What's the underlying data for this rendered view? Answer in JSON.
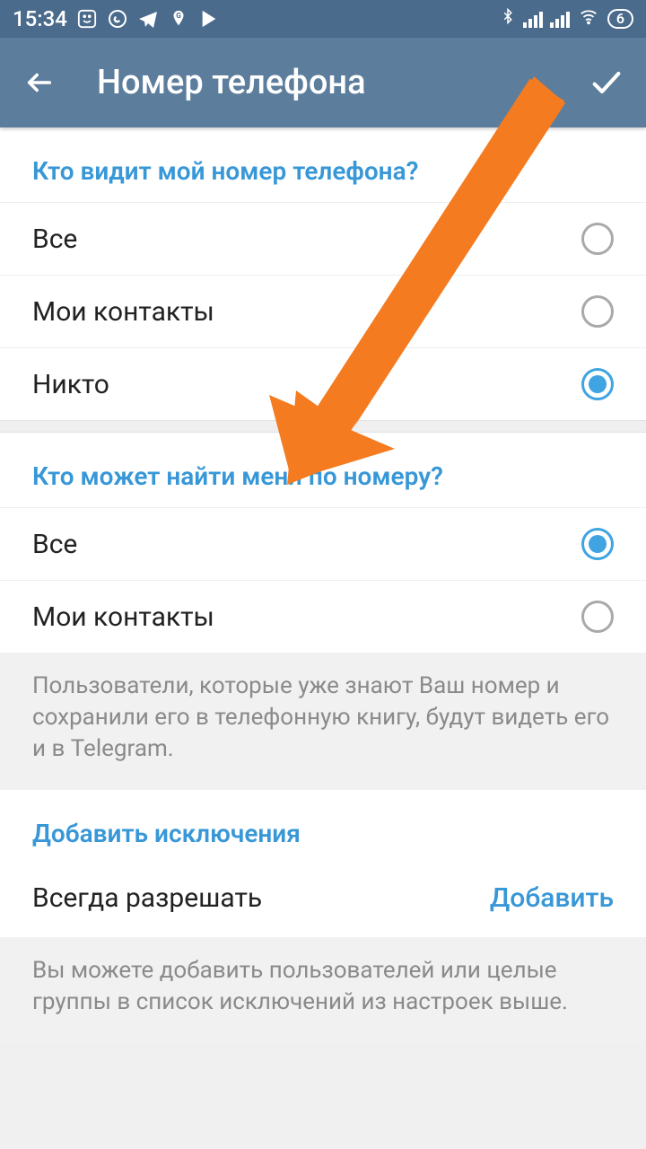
{
  "status": {
    "time": "15:34",
    "battery": "6",
    "icons": [
      "smile",
      "whatsapp",
      "telegram-plane",
      "maps",
      "play"
    ]
  },
  "appbar": {
    "title": "Номер телефона"
  },
  "section1": {
    "header": "Кто видит мой номер телефона?",
    "options": [
      {
        "label": "Все",
        "checked": false
      },
      {
        "label": "Мои контакты",
        "checked": false
      },
      {
        "label": "Никто",
        "checked": true
      }
    ]
  },
  "section2": {
    "header": "Кто может найти меня по номеру?",
    "options": [
      {
        "label": "Все",
        "checked": true
      },
      {
        "label": "Мои контакты",
        "checked": false
      }
    ],
    "note": "Пользователи, которые уже знают Ваш номер и сохранили его в телефонную книгу, будут видеть его и в Telegram."
  },
  "section3": {
    "header": "Добавить исключения",
    "row_label": "Всегда разрешать",
    "row_action": "Добавить",
    "note": "Вы можете добавить пользователей или целые группы в список исключений из настроек выше."
  }
}
